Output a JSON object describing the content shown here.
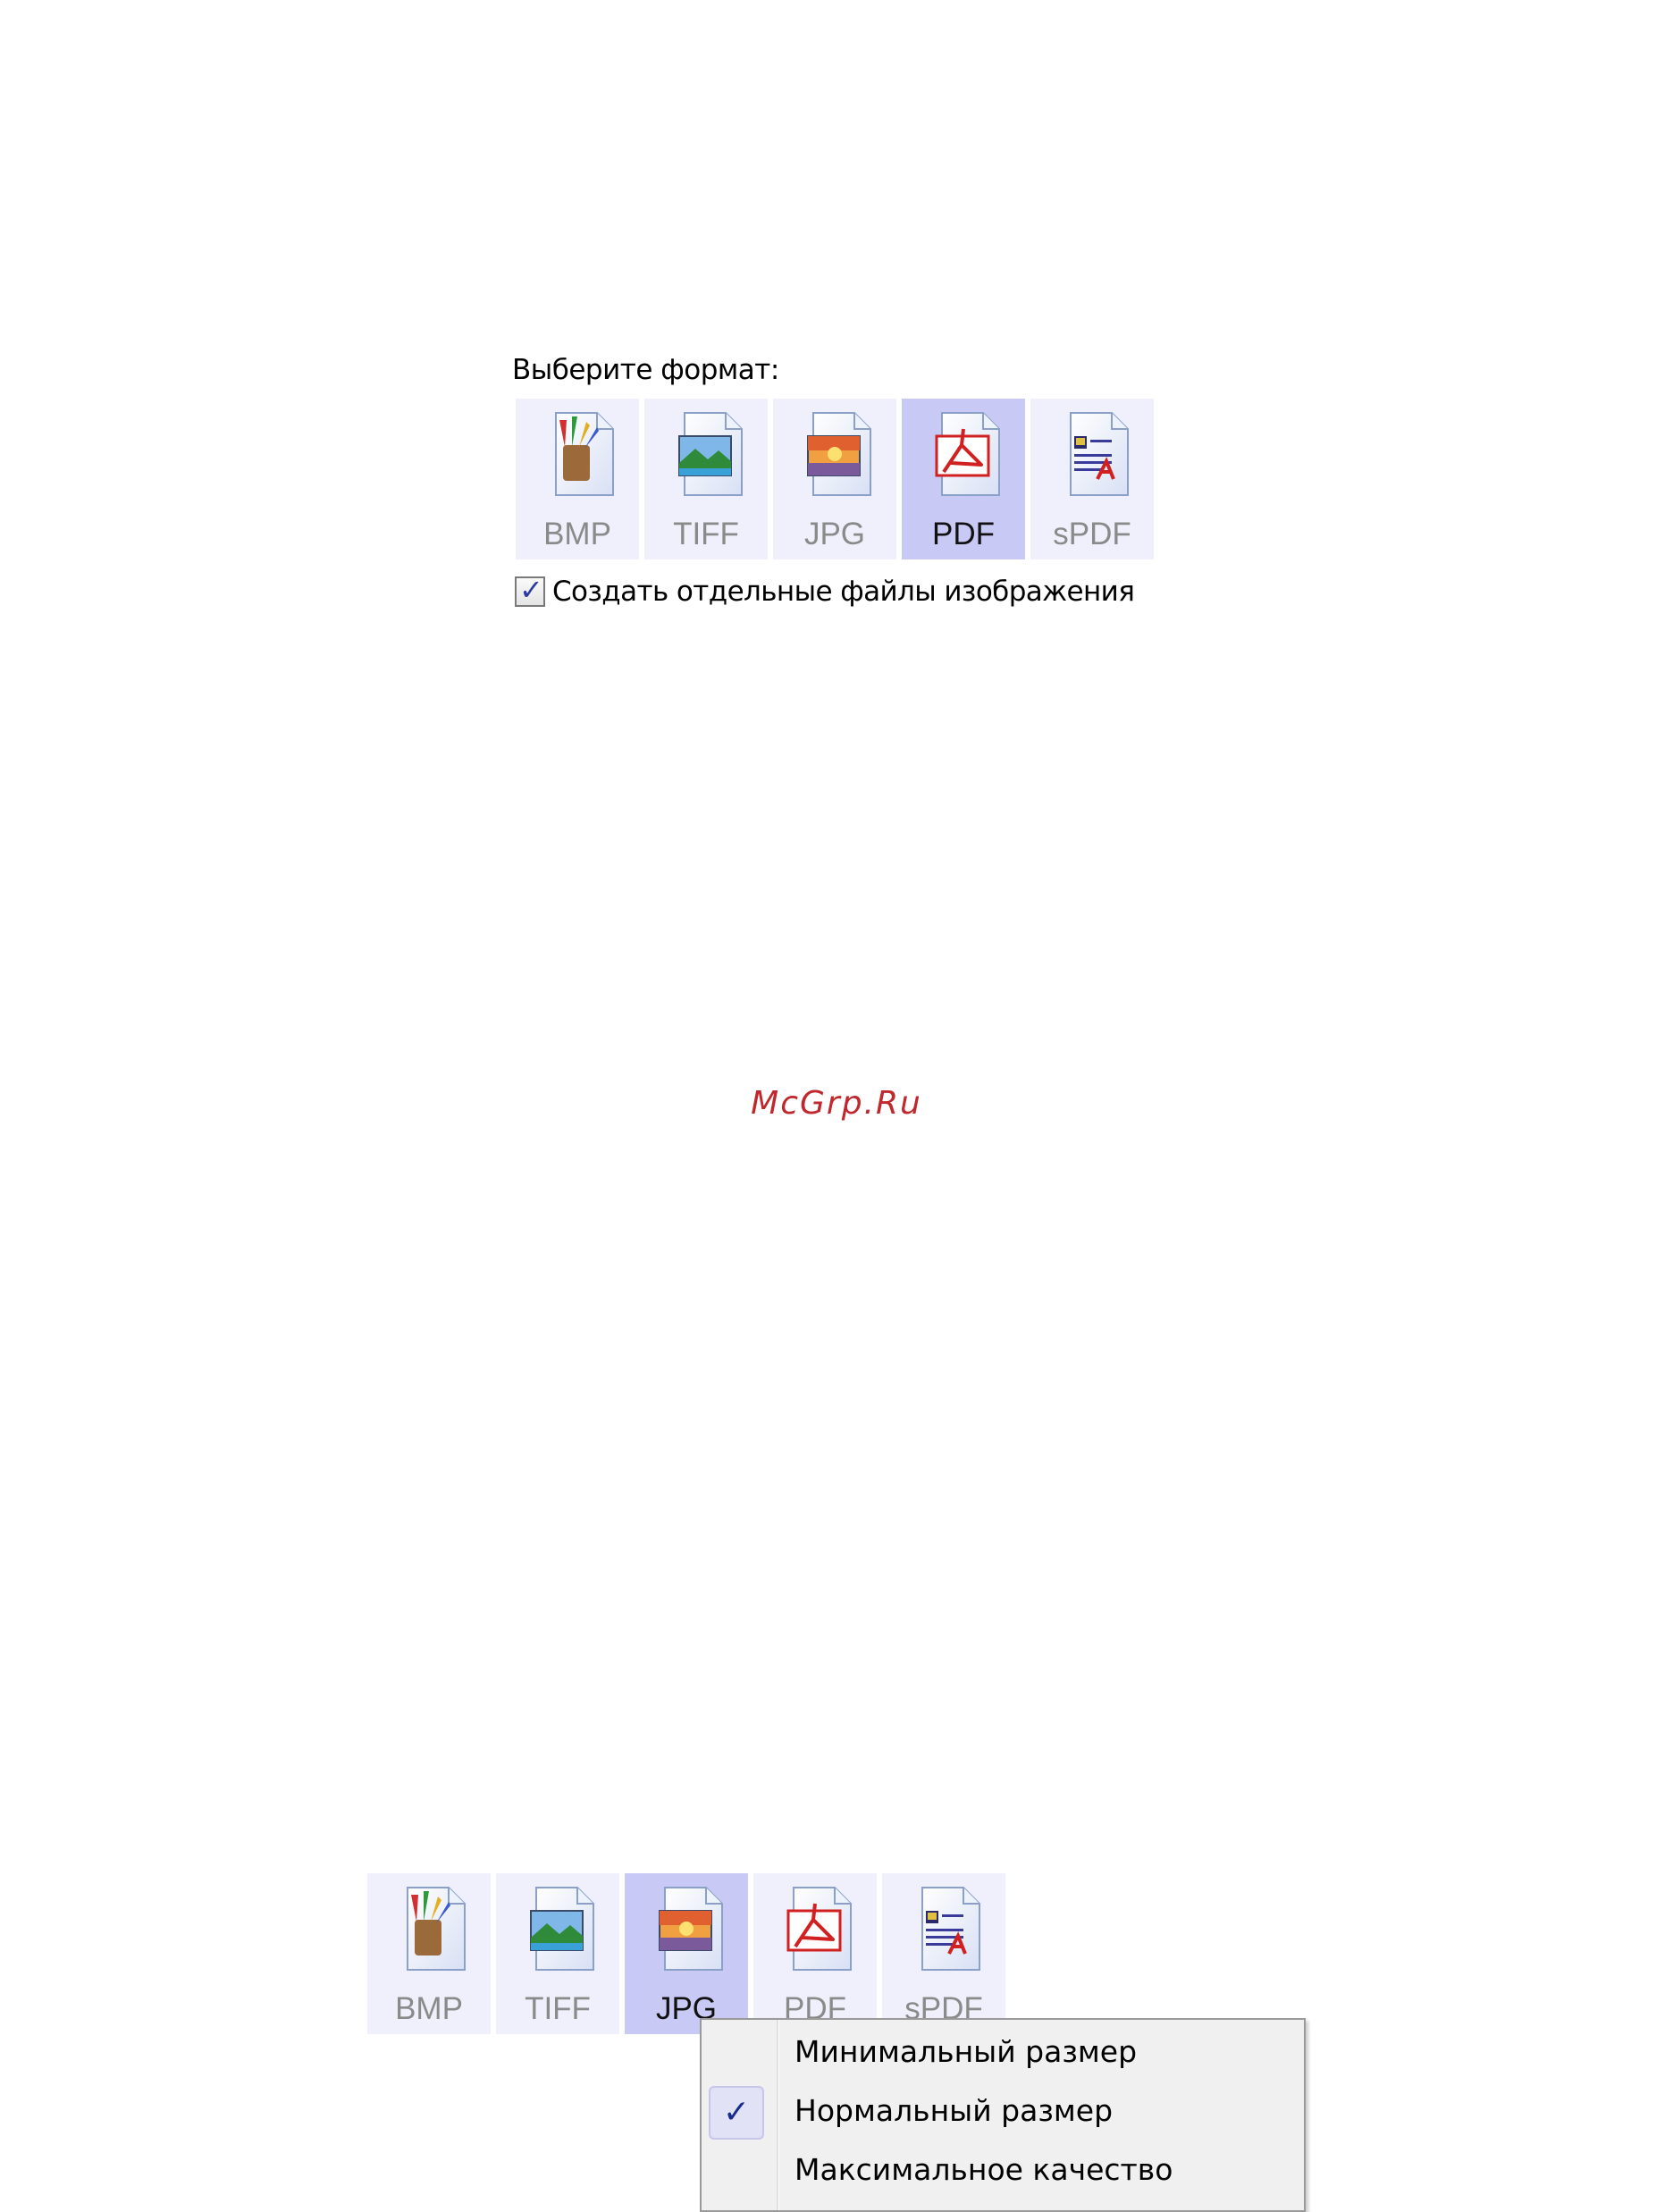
{
  "top_panel": {
    "prompt": "Выберите формат:",
    "formats": [
      {
        "label": "BMP",
        "icon": "bmp-file-icon",
        "selected": false
      },
      {
        "label": "TIFF",
        "icon": "tiff-file-icon",
        "selected": false
      },
      {
        "label": "JPG",
        "icon": "jpg-file-icon",
        "selected": false
      },
      {
        "label": "PDF",
        "icon": "pdf-file-icon",
        "selected": true
      },
      {
        "label": "sPDF",
        "icon": "spdf-file-icon",
        "selected": false
      }
    ],
    "checkbox": {
      "label": "Создать отдельные файлы изображения",
      "checked": true
    }
  },
  "watermark": "McGrp.Ru",
  "bottom_panel": {
    "formats": [
      {
        "label": "BMP",
        "icon": "bmp-file-icon",
        "selected": false
      },
      {
        "label": "TIFF",
        "icon": "tiff-file-icon",
        "selected": false
      },
      {
        "label": "JPG",
        "icon": "jpg-file-icon",
        "selected": true
      },
      {
        "label": "PDF",
        "icon": "pdf-file-icon",
        "selected": false
      },
      {
        "label": "sPDF",
        "icon": "spdf-file-icon",
        "selected": false
      }
    ],
    "context_menu": {
      "items": [
        {
          "label": "Минимальный размер",
          "checked": false
        },
        {
          "label": "Нормальный размер",
          "checked": true
        },
        {
          "label": "Максимальное качество",
          "checked": false
        }
      ]
    }
  },
  "colors": {
    "tile_bg": "#f0f0fc",
    "tile_selected_bg": "#c9c9f6",
    "watermark": "#c0282d"
  }
}
